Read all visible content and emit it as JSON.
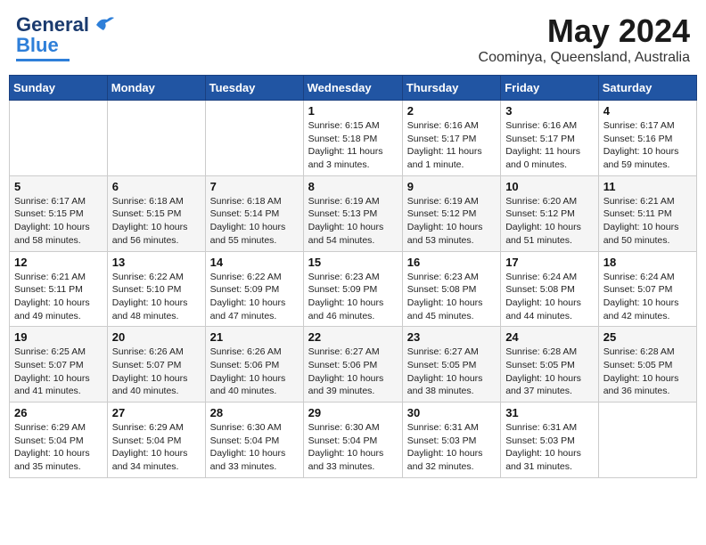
{
  "logo": {
    "text1": "General",
    "text2": "Blue"
  },
  "title": "May 2024",
  "subtitle": "Coominya, Queensland, Australia",
  "days_of_week": [
    "Sunday",
    "Monday",
    "Tuesday",
    "Wednesday",
    "Thursday",
    "Friday",
    "Saturday"
  ],
  "weeks": [
    [
      {
        "day": "",
        "info": ""
      },
      {
        "day": "",
        "info": ""
      },
      {
        "day": "",
        "info": ""
      },
      {
        "day": "1",
        "info": "Sunrise: 6:15 AM\nSunset: 5:18 PM\nDaylight: 11 hours and 3 minutes."
      },
      {
        "day": "2",
        "info": "Sunrise: 6:16 AM\nSunset: 5:17 PM\nDaylight: 11 hours and 1 minute."
      },
      {
        "day": "3",
        "info": "Sunrise: 6:16 AM\nSunset: 5:17 PM\nDaylight: 11 hours and 0 minutes."
      },
      {
        "day": "4",
        "info": "Sunrise: 6:17 AM\nSunset: 5:16 PM\nDaylight: 10 hours and 59 minutes."
      }
    ],
    [
      {
        "day": "5",
        "info": "Sunrise: 6:17 AM\nSunset: 5:15 PM\nDaylight: 10 hours and 58 minutes."
      },
      {
        "day": "6",
        "info": "Sunrise: 6:18 AM\nSunset: 5:15 PM\nDaylight: 10 hours and 56 minutes."
      },
      {
        "day": "7",
        "info": "Sunrise: 6:18 AM\nSunset: 5:14 PM\nDaylight: 10 hours and 55 minutes."
      },
      {
        "day": "8",
        "info": "Sunrise: 6:19 AM\nSunset: 5:13 PM\nDaylight: 10 hours and 54 minutes."
      },
      {
        "day": "9",
        "info": "Sunrise: 6:19 AM\nSunset: 5:12 PM\nDaylight: 10 hours and 53 minutes."
      },
      {
        "day": "10",
        "info": "Sunrise: 6:20 AM\nSunset: 5:12 PM\nDaylight: 10 hours and 51 minutes."
      },
      {
        "day": "11",
        "info": "Sunrise: 6:21 AM\nSunset: 5:11 PM\nDaylight: 10 hours and 50 minutes."
      }
    ],
    [
      {
        "day": "12",
        "info": "Sunrise: 6:21 AM\nSunset: 5:11 PM\nDaylight: 10 hours and 49 minutes."
      },
      {
        "day": "13",
        "info": "Sunrise: 6:22 AM\nSunset: 5:10 PM\nDaylight: 10 hours and 48 minutes."
      },
      {
        "day": "14",
        "info": "Sunrise: 6:22 AM\nSunset: 5:09 PM\nDaylight: 10 hours and 47 minutes."
      },
      {
        "day": "15",
        "info": "Sunrise: 6:23 AM\nSunset: 5:09 PM\nDaylight: 10 hours and 46 minutes."
      },
      {
        "day": "16",
        "info": "Sunrise: 6:23 AM\nSunset: 5:08 PM\nDaylight: 10 hours and 45 minutes."
      },
      {
        "day": "17",
        "info": "Sunrise: 6:24 AM\nSunset: 5:08 PM\nDaylight: 10 hours and 44 minutes."
      },
      {
        "day": "18",
        "info": "Sunrise: 6:24 AM\nSunset: 5:07 PM\nDaylight: 10 hours and 42 minutes."
      }
    ],
    [
      {
        "day": "19",
        "info": "Sunrise: 6:25 AM\nSunset: 5:07 PM\nDaylight: 10 hours and 41 minutes."
      },
      {
        "day": "20",
        "info": "Sunrise: 6:26 AM\nSunset: 5:07 PM\nDaylight: 10 hours and 40 minutes."
      },
      {
        "day": "21",
        "info": "Sunrise: 6:26 AM\nSunset: 5:06 PM\nDaylight: 10 hours and 40 minutes."
      },
      {
        "day": "22",
        "info": "Sunrise: 6:27 AM\nSunset: 5:06 PM\nDaylight: 10 hours and 39 minutes."
      },
      {
        "day": "23",
        "info": "Sunrise: 6:27 AM\nSunset: 5:05 PM\nDaylight: 10 hours and 38 minutes."
      },
      {
        "day": "24",
        "info": "Sunrise: 6:28 AM\nSunset: 5:05 PM\nDaylight: 10 hours and 37 minutes."
      },
      {
        "day": "25",
        "info": "Sunrise: 6:28 AM\nSunset: 5:05 PM\nDaylight: 10 hours and 36 minutes."
      }
    ],
    [
      {
        "day": "26",
        "info": "Sunrise: 6:29 AM\nSunset: 5:04 PM\nDaylight: 10 hours and 35 minutes."
      },
      {
        "day": "27",
        "info": "Sunrise: 6:29 AM\nSunset: 5:04 PM\nDaylight: 10 hours and 34 minutes."
      },
      {
        "day": "28",
        "info": "Sunrise: 6:30 AM\nSunset: 5:04 PM\nDaylight: 10 hours and 33 minutes."
      },
      {
        "day": "29",
        "info": "Sunrise: 6:30 AM\nSunset: 5:04 PM\nDaylight: 10 hours and 33 minutes."
      },
      {
        "day": "30",
        "info": "Sunrise: 6:31 AM\nSunset: 5:03 PM\nDaylight: 10 hours and 32 minutes."
      },
      {
        "day": "31",
        "info": "Sunrise: 6:31 AM\nSunset: 5:03 PM\nDaylight: 10 hours and 31 minutes."
      },
      {
        "day": "",
        "info": ""
      }
    ]
  ]
}
